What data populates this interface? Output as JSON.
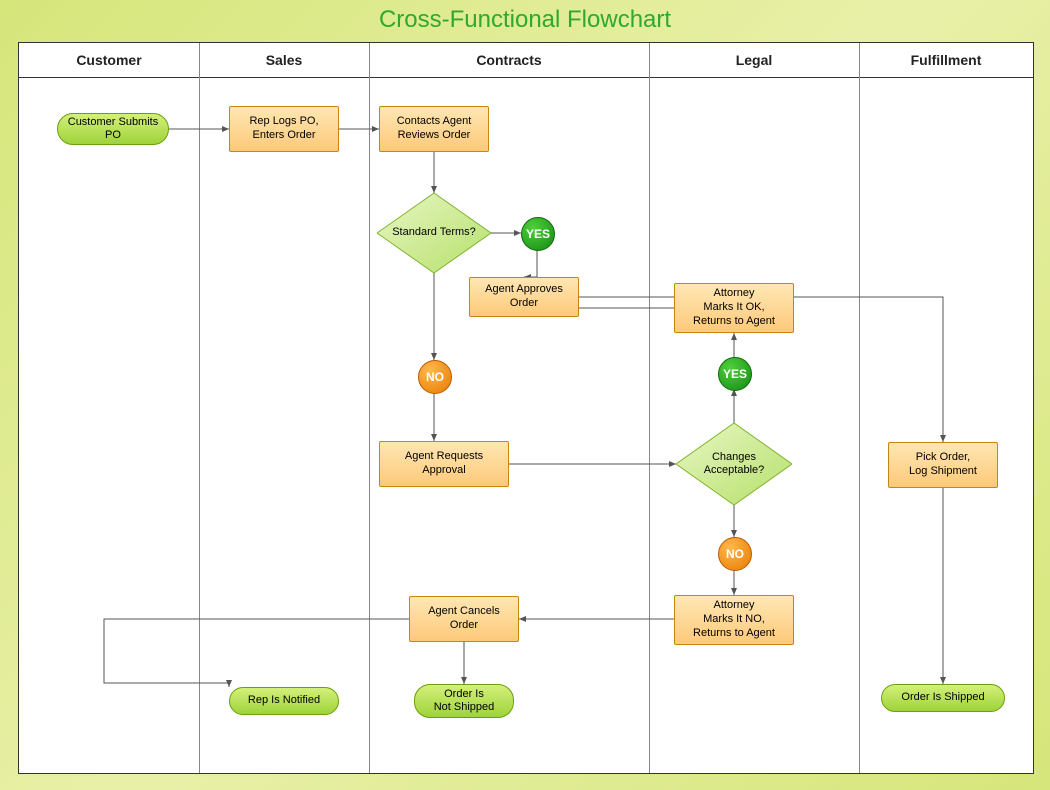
{
  "title": "Cross-Functional Flowchart",
  "lanes": {
    "customer": "Customer",
    "sales": "Sales",
    "contracts": "Contracts",
    "legal": "Legal",
    "fulfillment": "Fulfillment"
  },
  "nodes": {
    "customer_submits": "Customer Submits\nPO",
    "rep_logs": "Rep Logs PO,\nEnters Order",
    "contacts_agent": "Contacts Agent\nReviews Order",
    "standard_terms": "Standard Terms?",
    "yes1": "YES",
    "agent_approves": "Agent Approves\nOrder",
    "no1": "NO",
    "agent_requests": "Agent Requests\nApproval",
    "changes_acceptable": "Changes\nAcceptable?",
    "yes2": "YES",
    "attorney_ok": "Attorney\nMarks It OK,\nReturns to Agent",
    "no2": "NO",
    "attorney_no": "Attorney\nMarks It NO,\nReturns to Agent",
    "agent_cancels": "Agent Cancels\nOrder",
    "order_not_shipped": "Order Is\nNot Shipped",
    "rep_notified": "Rep Is Notified",
    "pick_order": "Pick Order,\nLog Shipment",
    "order_shipped": "Order Is Shipped"
  }
}
